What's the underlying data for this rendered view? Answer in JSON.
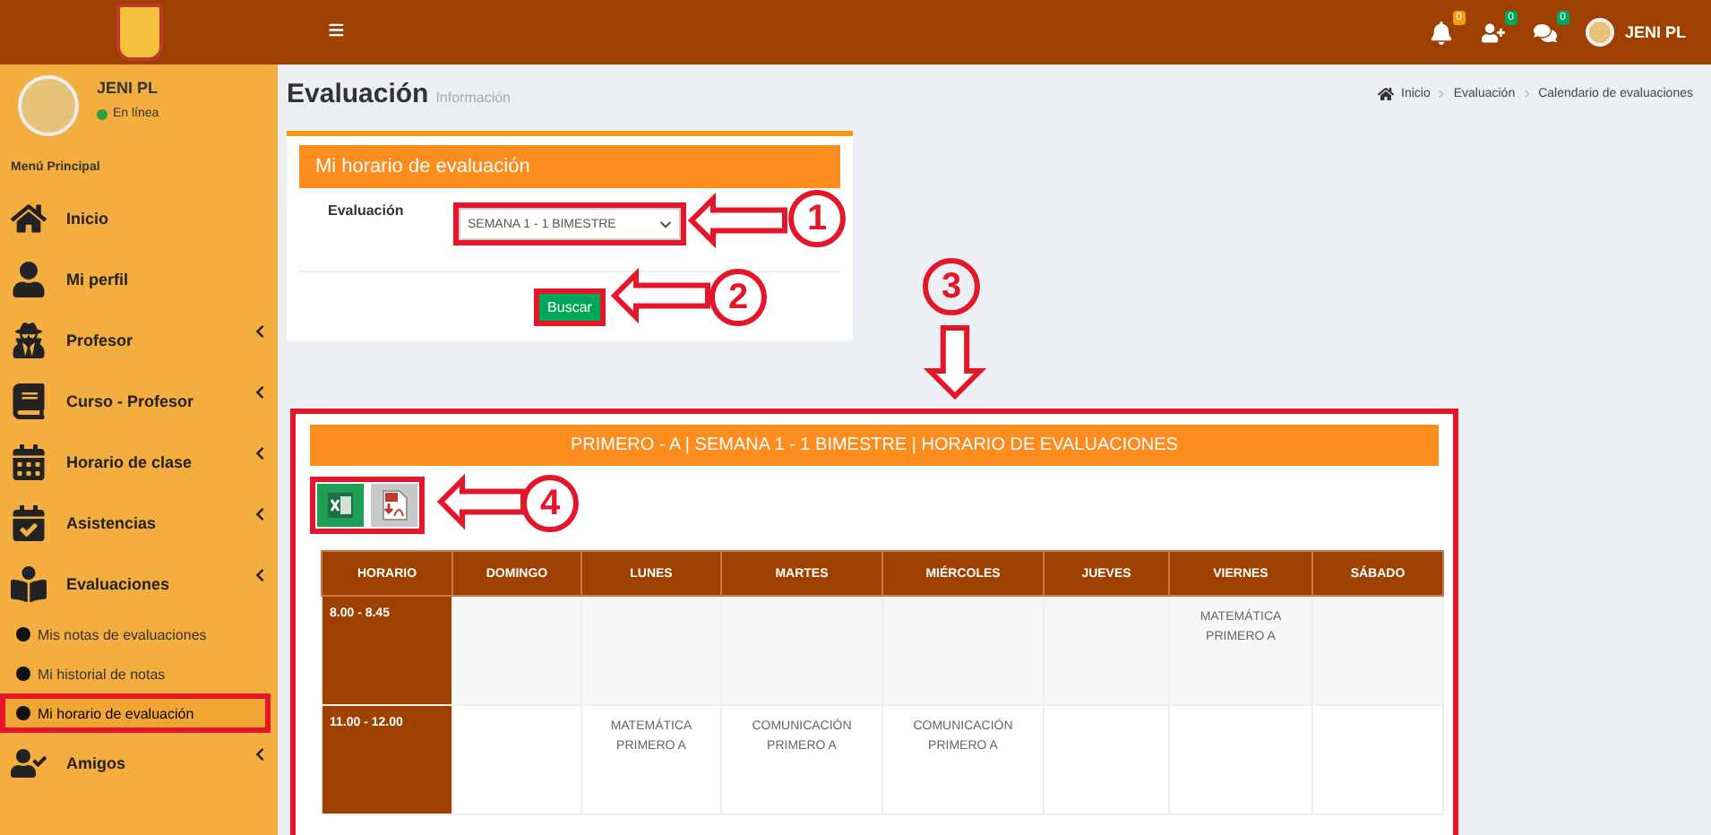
{
  "topbar": {
    "menu_glyph": "≡",
    "notifications": [
      {
        "count": "0",
        "color": "#f39c12"
      },
      {
        "count": "0",
        "color": "#00a65a"
      },
      {
        "count": "0",
        "color": "#00a65a"
      }
    ],
    "user_name": "JENI PL"
  },
  "sidebar": {
    "user": {
      "name": "JENI PL",
      "status": "En línea",
      "online": true
    },
    "heading": "Menú Principal",
    "items": [
      {
        "label": "Inicio",
        "expandable": false
      },
      {
        "label": "Mi perfil",
        "expandable": false
      },
      {
        "label": "Profesor",
        "expandable": true
      },
      {
        "label": "Curso - Profesor",
        "expandable": true
      },
      {
        "label": "Horario de clase",
        "expandable": true
      },
      {
        "label": "Asistencias",
        "expandable": true
      },
      {
        "label": "Evaluaciones",
        "expandable": true,
        "children": [
          {
            "label": "Mis notas de evaluaciones",
            "selected": false,
            "highlighted": false
          },
          {
            "label": "Mi historial de notas",
            "selected": false,
            "highlighted": false
          },
          {
            "label": "Mi horario de evaluación",
            "selected": true,
            "highlighted": true
          }
        ]
      },
      {
        "label": "Amigos",
        "expandable": true
      }
    ]
  },
  "page": {
    "title": "Evaluación",
    "subtitle": "Información",
    "breadcrumb": [
      "Inicio",
      "Evaluación",
      "Calendario de evaluaciones"
    ]
  },
  "form_card": {
    "title": "Mi horario de evaluación",
    "field_label": "Evaluación",
    "select": {
      "value": "SEMANA 1 - 1 BIMESTRE",
      "highlighted": true
    },
    "search_button": {
      "label": "Buscar",
      "highlighted": true
    }
  },
  "schedule_panel": {
    "highlighted": true,
    "title": "PRIMERO - A | SEMANA 1 - 1 BIMESTRE | HORARIO DE EVALUACIONES",
    "export_toolbar": {
      "highlighted": true
    },
    "table": {
      "columns": [
        "HORARIO",
        "DOMINGO",
        "LUNES",
        "MARTES",
        "MIÉRCOLES",
        "JUEVES",
        "VIERNES",
        "SÁBADO"
      ],
      "rows": [
        {
          "cells": [
            "8.00 - 8.45",
            "",
            "",
            "",
            "",
            "",
            "MATEMÁTICA PRIMERO A",
            ""
          ]
        },
        {
          "cells": [
            "11.00 - 12.00",
            "",
            "MATEMÁTICA PRIMERO A",
            "COMUNICACIÓN PRIMERO A",
            "COMUNICACIÓN PRIMERO A",
            "",
            "",
            ""
          ]
        }
      ]
    }
  },
  "annotations": [
    {
      "number": "1"
    },
    {
      "number": "2"
    },
    {
      "number": "3"
    },
    {
      "number": "4"
    }
  ]
}
